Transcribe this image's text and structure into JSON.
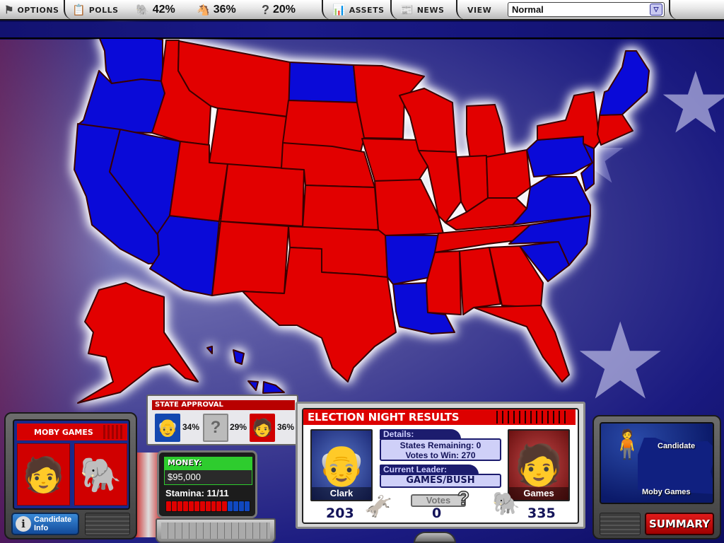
{
  "toolbar": {
    "options_label": "OPTIONS",
    "polls_label": "POLLS",
    "republican_pct": "42%",
    "democrat_pct": "36%",
    "undecided_pct": "20%",
    "assets_label": "ASSETS",
    "news_label": "NEWS",
    "view_label": "VIEW",
    "view_selected": "Normal",
    "icons": {
      "options": "flag-icon",
      "polls": "clipboard-icon",
      "republican": "elephant-icon",
      "democrat": "donkey-icon",
      "undecided": "question-mark-icon",
      "assets": "chart-board-icon",
      "news": "newspaper-icon",
      "dropdown": "chevron-down-icon"
    }
  },
  "map": {
    "colors": {
      "republican": "#e20000",
      "democrat": "#0a0ad8"
    },
    "democrat_states": [
      "WA",
      "OR",
      "CA",
      "NV",
      "AZ",
      "ND",
      "AR",
      "LA",
      "PA",
      "NJ",
      "DE",
      "MD",
      "VA",
      "WV",
      "NC",
      "SC",
      "VT",
      "NH",
      "ME",
      "HI"
    ],
    "republican_states": [
      "ID",
      "MT",
      "WY",
      "UT",
      "CO",
      "NM",
      "TX",
      "OK",
      "KS",
      "NE",
      "SD",
      "MN",
      "IA",
      "MO",
      "WI",
      "IL",
      "MI",
      "IN",
      "OH",
      "KY",
      "TN",
      "MS",
      "AL",
      "GA",
      "FL",
      "NY",
      "MA",
      "CT",
      "RI",
      "AK"
    ]
  },
  "candidate_panel": {
    "name": "MOBY GAMES",
    "party": "Republican",
    "info_button": "Candidate Info"
  },
  "state_approval": {
    "title": "STATE APPROVAL",
    "democrat_pct": "34%",
    "undecided_pct": "29%",
    "republican_pct": "36%"
  },
  "laptop": {
    "money_label": "MONEY:",
    "money_value": "$95,000",
    "stamina_label": "Stamina: 11/11",
    "stamina_current": 11,
    "stamina_max": 11
  },
  "results": {
    "title": "ELECTION NIGHT RESULTS",
    "details_label": "Details:",
    "states_remaining": "States Remaining: 0",
    "votes_to_win": "Votes to Win: 270",
    "leader_label": "Current Leader:",
    "leader_value": "GAMES/BUSH",
    "left_candidate": {
      "name": "Clark",
      "votes": "203"
    },
    "right_candidate": {
      "name": "Games",
      "votes": "335"
    },
    "votes_button": "Votes",
    "undecided_votes": "0"
  },
  "state_panel": {
    "line1": "Candidate",
    "line2": "Moby Games",
    "summary_button": "SUMMARY"
  }
}
